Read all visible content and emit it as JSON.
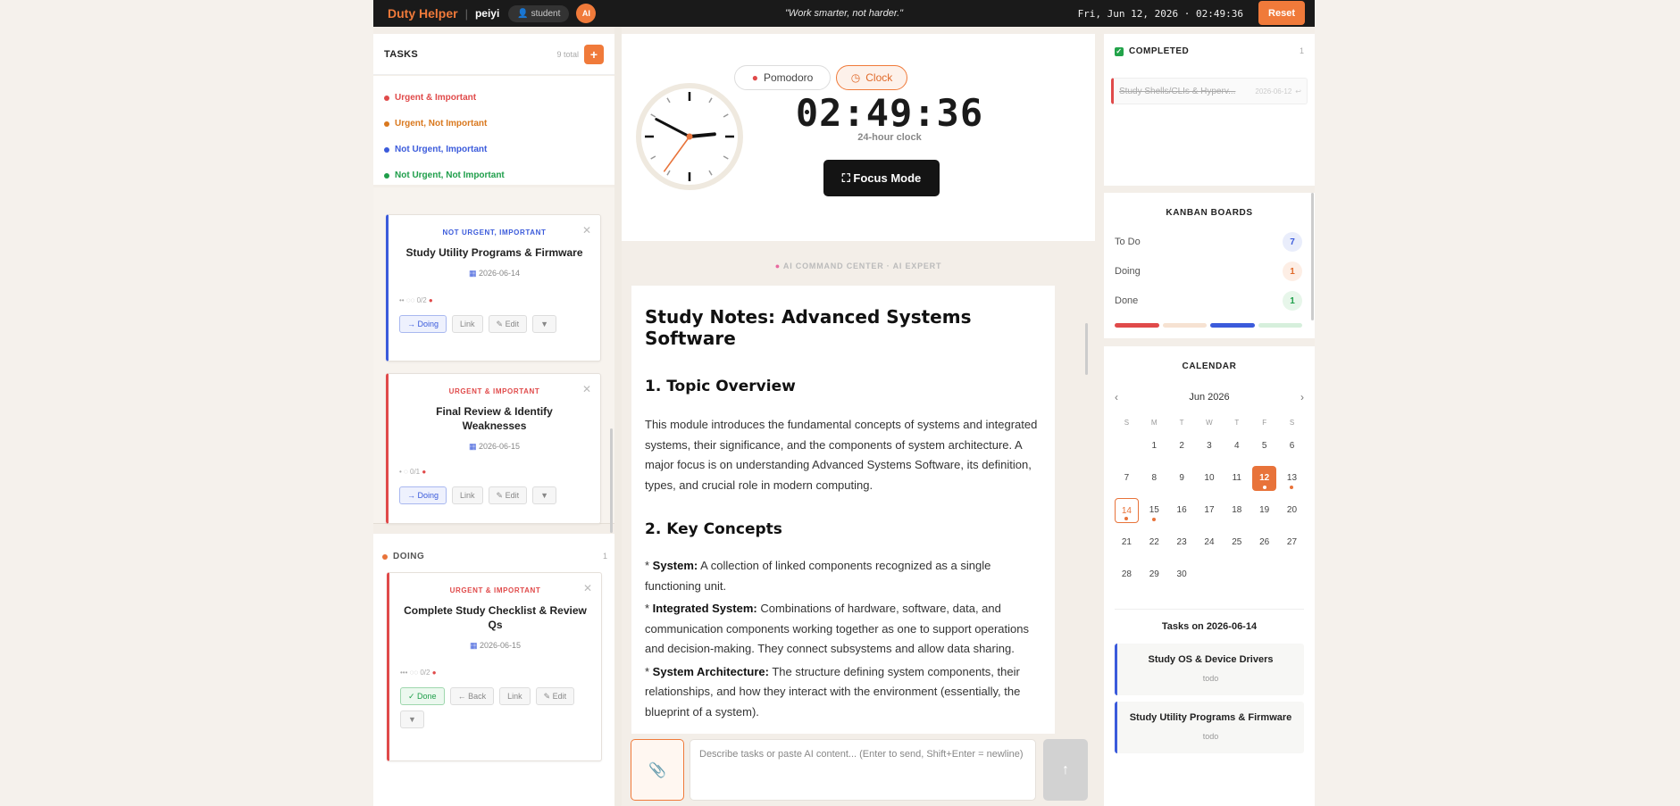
{
  "topbar": {
    "brand": "Duty Helper",
    "separator": "|",
    "username": "peiyi",
    "role": "student",
    "ai_badge": "AI",
    "motto": "\"Work smarter, not harder.\"",
    "datetime": "Fri, Jun 12, 2026 · 02:49:36",
    "reset_label": "Reset"
  },
  "tasks": {
    "title": "TASKS",
    "total": "9 total",
    "add_label": "+",
    "legend": [
      {
        "label": "Urgent & Important",
        "color": "#e04a4a"
      },
      {
        "label": "Urgent, Not Important",
        "color": "#d9781e"
      },
      {
        "label": "Not Urgent, Important",
        "color": "#3b5bdb"
      },
      {
        "label": "Not Urgent, Not Important",
        "color": "#1e9e4a"
      }
    ],
    "cards": [
      {
        "category": "NOT URGENT, IMPORTANT",
        "title": "Study Utility Programs & Firmware",
        "date": "2026-06-14",
        "progress": "0/2",
        "actions": [
          "→ Doing",
          "Link",
          "✎ Edit",
          "▼"
        ]
      },
      {
        "category": "URGENT & IMPORTANT",
        "title": "Final Review & Identify Weaknesses",
        "date": "2026-06-15",
        "progress": "0/1",
        "actions": [
          "→ Doing",
          "Link",
          "✎ Edit",
          "▼"
        ]
      }
    ],
    "doing": {
      "label": "DOING",
      "count": "1",
      "card": {
        "category": "URGENT & IMPORTANT",
        "title": "Complete Study Checklist & Review Qs",
        "date": "2026-06-15",
        "progress": "0/2",
        "actions": [
          "✓ Done",
          "← Back",
          "Link",
          "✎ Edit",
          "▼"
        ]
      }
    }
  },
  "clock": {
    "pomodoro_label": "Pomodoro",
    "clock_label": "Clock",
    "time": "02:49:36",
    "subtitle": "24-hour clock",
    "focus_label": "⛶ Focus Mode",
    "analog": {
      "hours": 2,
      "minutes": 49,
      "seconds": 36
    }
  },
  "ai": {
    "header": "AI COMMAND CENTER · AI EXPERT",
    "notes_title": "Study Notes: Advanced Systems Software",
    "s1_title": "1. Topic Overview",
    "s1_body": "This module introduces the fundamental concepts of systems and integrated systems, their significance, and the components of system architecture. A major focus is on understanding Advanced Systems Software, its definition, types, and crucial role in modern computing.",
    "s2_title": "2. Key Concepts",
    "concepts": [
      {
        "term": "System:",
        "text": " A collection of linked components recognized as a single functioning unit."
      },
      {
        "term": "Integrated System:",
        "text": " Combinations of hardware, software, data, and communication components working together as one to support operations and decision-making. They connect subsystems and allow data sharing."
      },
      {
        "term": "System Architecture:",
        "text": " The structure defining system components, their relationships, and how they interact with the environment (essentially, the blueprint of a system)."
      }
    ],
    "input_placeholder": "Describe tasks or paste AI content... (Enter to send, Shift+Enter = newline)",
    "send_label": "↑"
  },
  "completed": {
    "title": "COMPLETED",
    "count": "1",
    "item_title": "Study Shells/CLIs & Hyperv...",
    "item_date": "2026-06-12",
    "item_icon": "↩"
  },
  "kanban": {
    "title": "KANBAN BOARDS",
    "boards": [
      {
        "label": "To Do",
        "count": "7",
        "bg": "#e9edfb",
        "fg": "#3b5bdb"
      },
      {
        "label": "Doing",
        "count": "1",
        "bg": "#fdeee5",
        "fg": "#e06a2a"
      },
      {
        "label": "Done",
        "count": "1",
        "bg": "#e7f6ea",
        "fg": "#1e9e4a"
      }
    ],
    "bar_colors": [
      "#e04a4a",
      "#f6e2d2",
      "#3b5bdb",
      "#d6efdc"
    ]
  },
  "calendar": {
    "title": "CALENDAR",
    "month": "Jun 2026",
    "prev": "‹",
    "next": "›",
    "weekdays": [
      "S",
      "M",
      "T",
      "W",
      "T",
      "F",
      "S"
    ],
    "today": 12,
    "selected": 14,
    "event_days": [
      12,
      13,
      14,
      15
    ],
    "first_weekday": 1,
    "days_in_month": 30,
    "day_title": "Tasks on 2026-06-14",
    "day_tasks": [
      {
        "title": "Study OS & Device Drivers",
        "status": "todo"
      },
      {
        "title": "Study Utility Programs & Firmware",
        "status": "todo"
      }
    ]
  }
}
